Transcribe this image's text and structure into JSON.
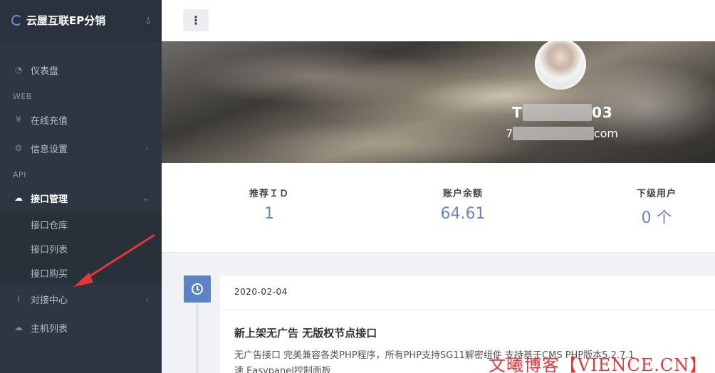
{
  "brand": {
    "title": "云屋互联EP分销",
    "drop_icon": "droplet-icon"
  },
  "sidebar": {
    "dashboard": "仪表盘",
    "section_web": "WEB",
    "recharge": "在线充值",
    "settings": "信息设置",
    "section_api": "API",
    "api_manage": "接口管理",
    "sub_items": [
      "接口仓库",
      "接口列表",
      "接口购买"
    ],
    "docking": "对接中心",
    "hosts": "主机列表",
    "yen_symbol": "¥"
  },
  "header": {
    "menu_icon": "⋮"
  },
  "profile": {
    "name_visible": "T",
    "name_tail": "03",
    "email_prefix": "7",
    "email_suffix": "com"
  },
  "stats": [
    {
      "label": "推荐ＩＤ",
      "value": "1"
    },
    {
      "label": "账户余额",
      "value": "64.61"
    },
    {
      "label": "下级用户",
      "value": "0 个"
    }
  ],
  "timeline": {
    "date": "2020-02-04",
    "title": "新上架无广告 无版权节点接口",
    "text": "无广告接口 完美兼容各类PHP程序，所有PHP支持SG11解密组件 支持基于CMS PHP版本5.2.7.1",
    "text2": "速 Easypanel控制面板"
  },
  "watermark": "文曦博客【VIENCE.CN】",
  "colors": {
    "accent": "#5c84c5",
    "sidebar": "#2e3643",
    "stat_value": "#6a85c6",
    "annotation": "#e0383a"
  }
}
